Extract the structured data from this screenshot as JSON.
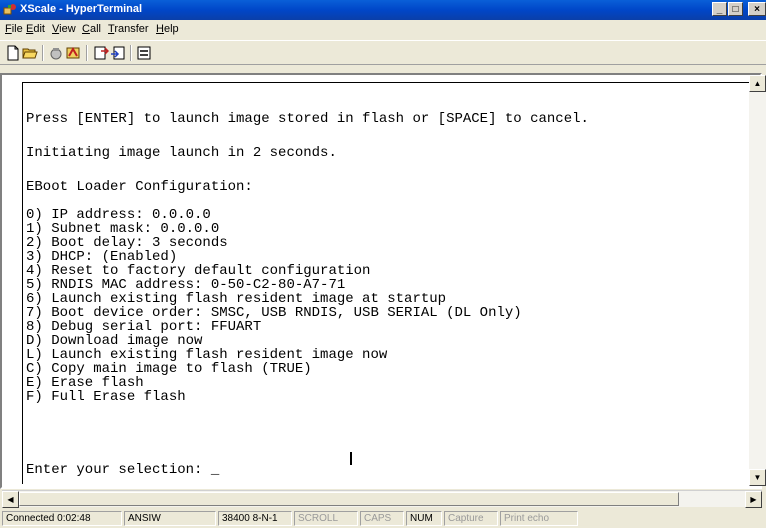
{
  "window": {
    "title": "XScale - HyperTerminal",
    "controls": [
      "_",
      "□",
      "×"
    ]
  },
  "menu": [
    {
      "key": "F",
      "rest": "ile"
    },
    {
      "key": "E",
      "rest": "dit"
    },
    {
      "key": "V",
      "rest": "iew"
    },
    {
      "key": "C",
      "rest": "all"
    },
    {
      "key": "T",
      "rest": "ransfer"
    },
    {
      "key": "H",
      "rest": "elp"
    }
  ],
  "toolbar": {
    "icons": [
      "new-icon",
      "open-icon",
      "disconnect-icon",
      "connect-icon",
      "send-icon",
      "receive-icon",
      "properties-icon"
    ]
  },
  "terminal": {
    "lines": [
      "",
      "Press [ENTER] to launch image stored in flash or [SPACE] to cancel.",
      "",
      "Initiating image launch in 2 seconds.",
      "",
      "EBoot Loader Configuration:",
      "",
      "0) IP address: 0.0.0.0",
      "1) Subnet mask: 0.0.0.0",
      "2) Boot delay: 3 seconds",
      "3) DHCP: (Enabled)",
      "4) Reset to factory default configuration",
      "5) RNDIS MAC address: 0-50-C2-80-A7-71",
      "6) Launch existing flash resident image at startup",
      "7) Boot device order: SMSC, USB RNDIS, USB SERIAL (DL Only)",
      "8) Debug serial port: FFUART",
      "D) Download image now",
      "L) Launch existing flash resident image now",
      "C) Copy main image to flash (TRUE)",
      "E) Erase flash",
      "F) Full Erase flash",
      "",
      "",
      "Enter your selection: _"
    ]
  },
  "status": {
    "connected": "Connected 0:02:48",
    "emulation": "ANSIW",
    "port": "38400 8-N-1",
    "scroll": "SCROLL",
    "caps": "CAPS",
    "num": "NUM",
    "capture": "Capture",
    "print_echo": "Print echo"
  },
  "colors": {
    "titlebar": "#0046c8",
    "chrome": "#ece9d8",
    "terminal_bg": "#ffffff"
  }
}
